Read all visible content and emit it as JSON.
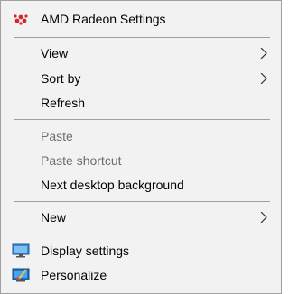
{
  "context_menu": {
    "amd": {
      "label": "AMD Radeon Settings",
      "icon": "amd-radeon-icon",
      "icon_color": "#d7262b"
    },
    "view": {
      "label": "View",
      "submenu": true
    },
    "sort_by": {
      "label": "Sort by",
      "submenu": true
    },
    "refresh": {
      "label": "Refresh"
    },
    "paste": {
      "label": "Paste",
      "disabled": true
    },
    "paste_shortcut": {
      "label": "Paste shortcut",
      "disabled": true
    },
    "next_bg": {
      "label": "Next desktop background"
    },
    "new": {
      "label": "New",
      "submenu": true
    },
    "display_settings": {
      "label": "Display settings",
      "icon": "display-icon"
    },
    "personalize": {
      "label": "Personalize",
      "icon": "personalize-icon"
    }
  },
  "colors": {
    "menu_background": "#f2f2f2",
    "border": "#a0a0a0",
    "disabled_text": "#6d6d6d"
  }
}
